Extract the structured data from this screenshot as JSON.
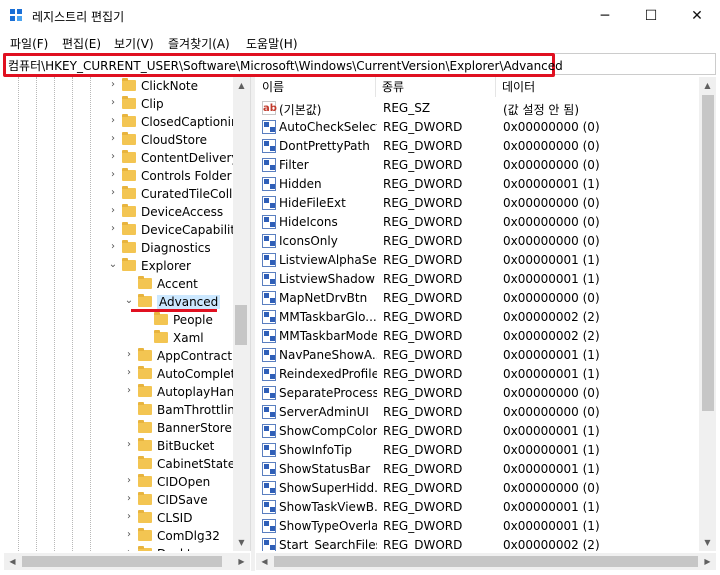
{
  "window": {
    "title": "레지스트리 편집기",
    "minimize": "─",
    "maximize": "☐",
    "close": "✕"
  },
  "menu": [
    "파일(F)",
    "편집(E)",
    "보기(V)",
    "즐겨찾기(A)",
    "도움말(H)"
  ],
  "address": "컴퓨터\\HKEY_CURRENT_USER\\Software\\Microsoft\\Windows\\CurrentVersion\\Explorer\\Advanced",
  "tree": [
    {
      "label": "ClickNote",
      "level": 0,
      "chev": "›"
    },
    {
      "label": "Clip",
      "level": 0,
      "chev": "›"
    },
    {
      "label": "ClosedCaptioning",
      "level": 0,
      "chev": "›"
    },
    {
      "label": "CloudStore",
      "level": 0,
      "chev": "›"
    },
    {
      "label": "ContentDeliveryM",
      "level": 0,
      "chev": "›"
    },
    {
      "label": "Controls Folder (",
      "level": 0,
      "chev": "›"
    },
    {
      "label": "CuratedTileCollec",
      "level": 0,
      "chev": "›"
    },
    {
      "label": "DeviceAccess",
      "level": 0,
      "chev": "›"
    },
    {
      "label": "DeviceCapabilitie",
      "level": 0,
      "chev": "›"
    },
    {
      "label": "Diagnostics",
      "level": 0,
      "chev": "›"
    },
    {
      "label": "Explorer",
      "level": 0,
      "chev": "⌄"
    },
    {
      "label": "Accent",
      "level": 1,
      "chev": ""
    },
    {
      "label": "Advanced",
      "level": 1,
      "chev": "⌄",
      "selected": true
    },
    {
      "label": "People",
      "level": 2,
      "chev": ""
    },
    {
      "label": "Xaml",
      "level": 2,
      "chev": ""
    },
    {
      "label": "AppContract",
      "level": 1,
      "chev": "›"
    },
    {
      "label": "AutoComplete",
      "level": 1,
      "chev": "›"
    },
    {
      "label": "AutoplayHand",
      "level": 1,
      "chev": "›"
    },
    {
      "label": "BamThrottling",
      "level": 1,
      "chev": ""
    },
    {
      "label": "BannerStore",
      "level": 1,
      "chev": ""
    },
    {
      "label": "BitBucket",
      "level": 1,
      "chev": "›"
    },
    {
      "label": "CabinetState",
      "level": 1,
      "chev": ""
    },
    {
      "label": "CIDOpen",
      "level": 1,
      "chev": "›"
    },
    {
      "label": "CIDSave",
      "level": 1,
      "chev": "›"
    },
    {
      "label": "CLSID",
      "level": 1,
      "chev": "›"
    },
    {
      "label": "ComDlg32",
      "level": 1,
      "chev": "›"
    },
    {
      "label": "Desktop",
      "level": 1,
      "chev": "›"
    }
  ],
  "columns": {
    "name": "이름",
    "type": "종류",
    "data": "데이터"
  },
  "values": [
    {
      "icon": "string",
      "name": "(기본값)",
      "type": "REG_SZ",
      "data": "(값 설정 안 됨)"
    },
    {
      "icon": "binary",
      "name": "AutoCheckSelect",
      "type": "REG_DWORD",
      "data": "0x00000000 (0)"
    },
    {
      "icon": "binary",
      "name": "DontPrettyPath",
      "type": "REG_DWORD",
      "data": "0x00000000 (0)"
    },
    {
      "icon": "binary",
      "name": "Filter",
      "type": "REG_DWORD",
      "data": "0x00000000 (0)"
    },
    {
      "icon": "binary",
      "name": "Hidden",
      "type": "REG_DWORD",
      "data": "0x00000001 (1)"
    },
    {
      "icon": "binary",
      "name": "HideFileExt",
      "type": "REG_DWORD",
      "data": "0x00000000 (0)"
    },
    {
      "icon": "binary",
      "name": "HideIcons",
      "type": "REG_DWORD",
      "data": "0x00000000 (0)"
    },
    {
      "icon": "binary",
      "name": "IconsOnly",
      "type": "REG_DWORD",
      "data": "0x00000000 (0)"
    },
    {
      "icon": "binary",
      "name": "ListviewAlphaSe...",
      "type": "REG_DWORD",
      "data": "0x00000001 (1)"
    },
    {
      "icon": "binary",
      "name": "ListviewShadow",
      "type": "REG_DWORD",
      "data": "0x00000001 (1)"
    },
    {
      "icon": "binary",
      "name": "MapNetDrvBtn",
      "type": "REG_DWORD",
      "data": "0x00000000 (0)"
    },
    {
      "icon": "binary",
      "name": "MMTaskbarGlo...",
      "type": "REG_DWORD",
      "data": "0x00000002 (2)"
    },
    {
      "icon": "binary",
      "name": "MMTaskbarMode",
      "type": "REG_DWORD",
      "data": "0x00000002 (2)"
    },
    {
      "icon": "binary",
      "name": "NavPaneShowA...",
      "type": "REG_DWORD",
      "data": "0x00000001 (1)"
    },
    {
      "icon": "binary",
      "name": "ReindexedProfile",
      "type": "REG_DWORD",
      "data": "0x00000001 (1)"
    },
    {
      "icon": "binary",
      "name": "SeparateProcess",
      "type": "REG_DWORD",
      "data": "0x00000000 (0)"
    },
    {
      "icon": "binary",
      "name": "ServerAdminUI",
      "type": "REG_DWORD",
      "data": "0x00000000 (0)"
    },
    {
      "icon": "binary",
      "name": "ShowCompColor",
      "type": "REG_DWORD",
      "data": "0x00000001 (1)"
    },
    {
      "icon": "binary",
      "name": "ShowInfoTip",
      "type": "REG_DWORD",
      "data": "0x00000001 (1)"
    },
    {
      "icon": "binary",
      "name": "ShowStatusBar",
      "type": "REG_DWORD",
      "data": "0x00000001 (1)"
    },
    {
      "icon": "binary",
      "name": "ShowSuperHidd...",
      "type": "REG_DWORD",
      "data": "0x00000000 (0)"
    },
    {
      "icon": "binary",
      "name": "ShowTaskViewB...",
      "type": "REG_DWORD",
      "data": "0x00000001 (1)"
    },
    {
      "icon": "binary",
      "name": "ShowTypeOverlay",
      "type": "REG_DWORD",
      "data": "0x00000001 (1)"
    },
    {
      "icon": "binary",
      "name": "Start_SearchFiles",
      "type": "REG_DWORD",
      "data": "0x00000002 (2)"
    }
  ],
  "colors": {
    "highlight": "#e01020",
    "selection": "#cce8ff",
    "folder": "#f3c552"
  }
}
